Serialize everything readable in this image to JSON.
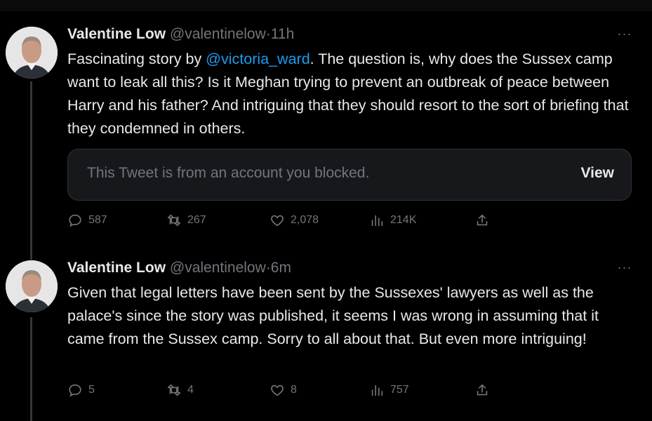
{
  "tweets": [
    {
      "name": "Valentine Low",
      "handle": "@valentinelow",
      "separator": "·",
      "time": "11h",
      "text_parts": {
        "before": "Fascinating story by ",
        "mention": "@victoria_ward",
        "after": ". The question is, why does the Sussex camp want to leak all this? Is it Meghan trying to prevent an outbreak of peace between Harry and his father? And intriguing that they should resort to the sort of briefing that they condemned in others."
      },
      "blocked_notice": "This Tweet is from an account you blocked.",
      "blocked_view_label": "View",
      "more_label": "···",
      "replies": "587",
      "retweets": "267",
      "likes": "2,078",
      "views": "214K"
    },
    {
      "name": "Valentine Low",
      "handle": "@valentinelow",
      "separator": "·",
      "time": "6m",
      "text": "Given that legal letters have been sent by the Sussexes' lawyers as well as the palace's since the story was published, it seems I was wrong in assuming that it came from the Sussex camp. Sorry to all about that. But even more intriguing!",
      "more_label": "···",
      "replies": "5",
      "retweets": "4",
      "likes": "8",
      "views": "757"
    }
  ],
  "icons": {
    "reply": "reply-icon",
    "retweet": "retweet-icon",
    "like": "heart-icon",
    "views": "views-icon",
    "share": "share-icon",
    "more": "more-icon"
  },
  "colors": {
    "background": "#000000",
    "text": "#e7e9ea",
    "secondary": "#71767b",
    "link": "#1d9bf0"
  }
}
